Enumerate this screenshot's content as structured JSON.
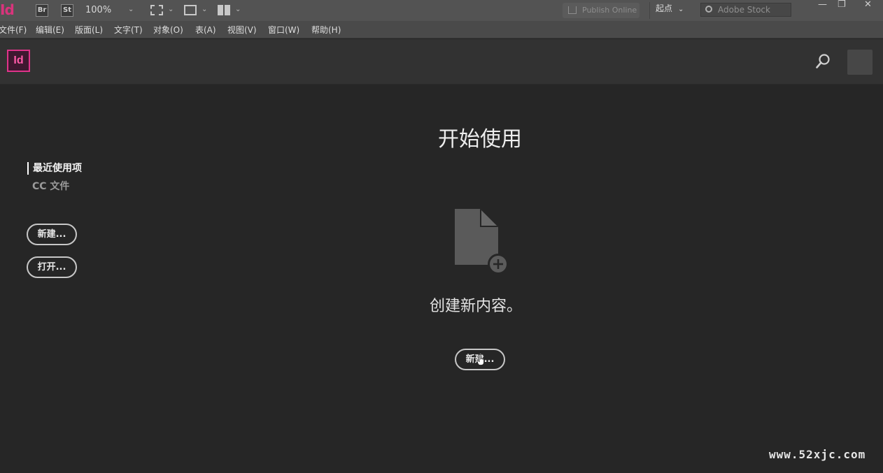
{
  "appbar": {
    "app_mark": "Id",
    "bridge_label": "Br",
    "stock_label": "St",
    "zoom": "100%",
    "publish_label": "Publish Online",
    "workspace_label": "起点",
    "stock_search_placeholder": "Adobe Stock",
    "minimize_glyph": "—",
    "restore_glyph": "❐",
    "close_glyph": "✕"
  },
  "menu": [
    {
      "label": "文件(F)"
    },
    {
      "label": "编辑(E)"
    },
    {
      "label": "版面(L)"
    },
    {
      "label": "文字(T)"
    },
    {
      "label": "对象(O)"
    },
    {
      "label": "表(A)"
    },
    {
      "label": "视图(V)"
    },
    {
      "label": "窗口(W)"
    },
    {
      "label": "帮助(H)"
    }
  ],
  "home": {
    "logo_text": "Id"
  },
  "sidebar": {
    "recent_label": "最近使用项",
    "cc_files_label": "CC 文件",
    "new_button": "新建...",
    "open_button": "打开..."
  },
  "main": {
    "title": "开始使用",
    "create_text": "创建新内容。",
    "new_button": "新建..."
  },
  "watermark": "www.52xjc.com",
  "colors": {
    "accent_pink": "#e0338a",
    "background": "#262626",
    "appbar": "#535353",
    "menubar": "#4a4a4a",
    "header": "#323232"
  }
}
